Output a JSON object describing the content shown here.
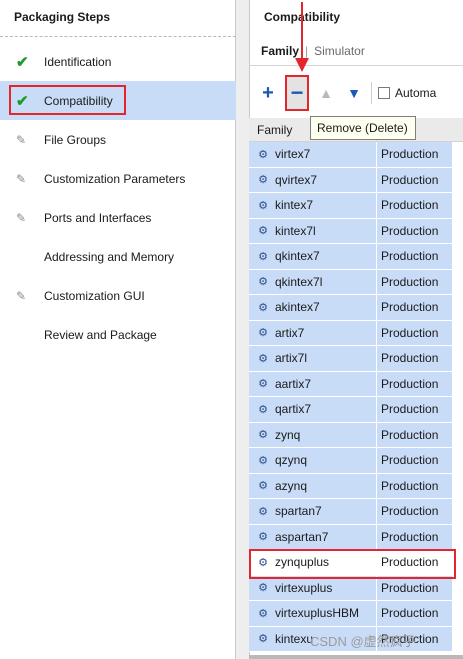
{
  "left": {
    "title": "Packaging Steps",
    "steps": [
      {
        "label": "Identification",
        "icon": "check-icon",
        "selected": false
      },
      {
        "label": "Compatibility",
        "icon": "check-icon",
        "selected": true
      },
      {
        "label": "File Groups",
        "icon": "pencil-icon",
        "selected": false
      },
      {
        "label": "Customization Parameters",
        "icon": "pencil-icon",
        "selected": false
      },
      {
        "label": "Ports and Interfaces",
        "icon": "pencil-icon",
        "selected": false
      },
      {
        "label": "Addressing and Memory",
        "icon": "",
        "selected": false
      },
      {
        "label": "Customization GUI",
        "icon": "pencil-icon",
        "selected": false
      },
      {
        "label": "Review and Package",
        "icon": "",
        "selected": false
      }
    ]
  },
  "right": {
    "title": "Compatibility",
    "tabs": {
      "active": "Family",
      "divider": "|",
      "inactive": "Simulator"
    },
    "toolbar": {
      "add": "+",
      "remove": "−",
      "automatic_label": "Automa"
    },
    "tooltip": "Remove (Delete)",
    "table": {
      "headers": [
        "Family",
        "Life Cycle"
      ],
      "header_visible": [
        "Family",
        "cle"
      ],
      "rows": [
        {
          "family": "virtex7",
          "status": "Production"
        },
        {
          "family": "qvirtex7",
          "status": "Production"
        },
        {
          "family": "kintex7",
          "status": "Production"
        },
        {
          "family": "kintex7l",
          "status": "Production"
        },
        {
          "family": "qkintex7",
          "status": "Production"
        },
        {
          "family": "qkintex7l",
          "status": "Production"
        },
        {
          "family": "akintex7",
          "status": "Production"
        },
        {
          "family": "artix7",
          "status": "Production"
        },
        {
          "family": "artix7l",
          "status": "Production"
        },
        {
          "family": "aartix7",
          "status": "Production"
        },
        {
          "family": "qartix7",
          "status": "Production"
        },
        {
          "family": "zynq",
          "status": "Production"
        },
        {
          "family": "qzynq",
          "status": "Production"
        },
        {
          "family": "azynq",
          "status": "Production"
        },
        {
          "family": "spartan7",
          "status": "Production"
        },
        {
          "family": "aspartan7",
          "status": "Production"
        },
        {
          "family": "zynquplus",
          "status": "Production",
          "highlight": true
        },
        {
          "family": "virtexuplus",
          "status": "Production"
        },
        {
          "family": "virtexuplusHBM",
          "status": "Production"
        },
        {
          "family": "kintexu",
          "status": "Production"
        }
      ]
    }
  },
  "watermark": "CSDN @虚然疯子",
  "colors": {
    "selection": "#c9dcf7",
    "annotation_red": "#e2262c",
    "check_green": "#1f9a2d",
    "toolbar_blue": "#1d58b3"
  }
}
